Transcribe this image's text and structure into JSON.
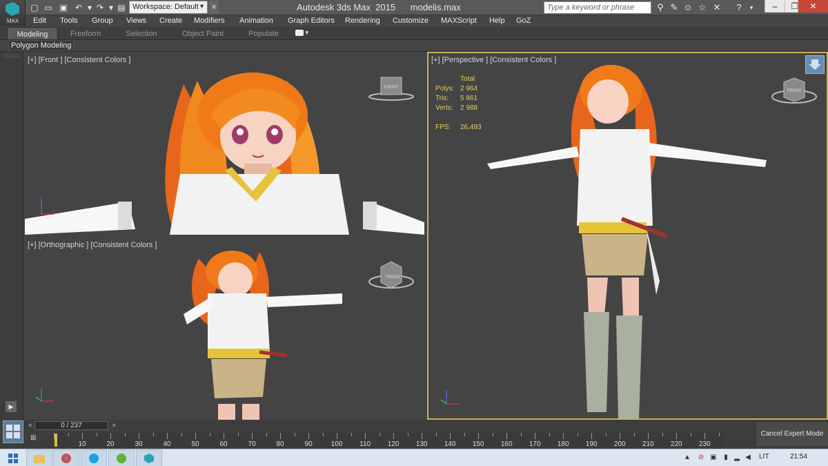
{
  "app": {
    "logo_text": "MAX",
    "title": "Autodesk 3ds Max  2015      modelis.max",
    "workspace": "Workspace: Default",
    "search_placeholder": "Type a keyword or phrase"
  },
  "menu": [
    "Edit",
    "Tools",
    "Group",
    "Views",
    "Create",
    "Modifiers",
    "Animation",
    "Graph Editors",
    "Rendering",
    "Customize",
    "MAXScript",
    "Help",
    "GoZ"
  ],
  "ribbon": {
    "tabs": [
      "Modeling",
      "Freeform",
      "Selection",
      "Object Paint",
      "Populate"
    ],
    "active_tab": "Modeling",
    "panel_label": "Polygon Modeling"
  },
  "viewports": {
    "front": {
      "label": "[+] [Front ] [Consistent Colors ]",
      "cube_label": "FRONT"
    },
    "orthographic": {
      "label": "[+] [Orthographic ] [Consistent Colors ]",
      "cube_label": "FRONT"
    },
    "perspective": {
      "label": "[+] [Perspective ] [Consistent Colors ]",
      "cube_label": "FRONT",
      "stats": {
        "header": "Total",
        "polys_label": "Polys:",
        "polys": "2 964",
        "tris_label": "Tris:",
        "tris": "5 861",
        "verts_label": "Verts:",
        "verts": "2 988",
        "fps_label": "FPS:",
        "fps": "26,493"
      }
    }
  },
  "timeline": {
    "slider_text": "0 / 237",
    "ticks": [
      "10",
      "20",
      "30",
      "40",
      "50",
      "60",
      "70",
      "80",
      "90",
      "100",
      "110",
      "120",
      "130",
      "140",
      "150",
      "160",
      "170",
      "180",
      "190",
      "200",
      "210",
      "220",
      "230"
    ],
    "cancel_expert": "Cancel Expert Mode"
  },
  "taskbar": {
    "language": "LIT",
    "clock": "21:54"
  },
  "colors": {
    "active_viewport_border": "#c7b35c",
    "stats_text": "#e6d05a",
    "timeline_head": "#dcbf3a"
  }
}
